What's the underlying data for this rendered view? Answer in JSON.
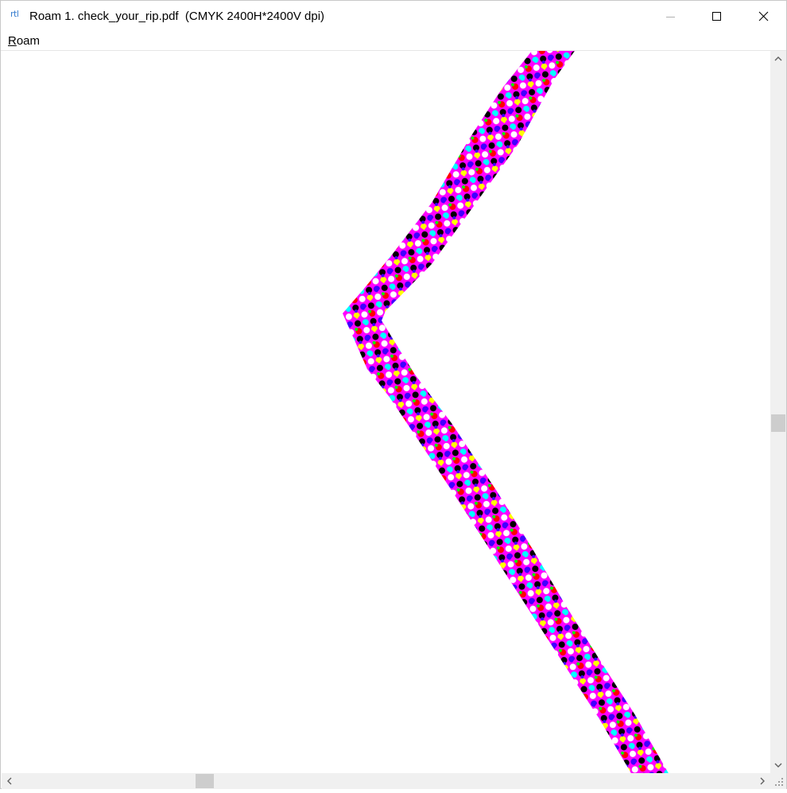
{
  "window": {
    "app_icon": "rtl",
    "title": "Roam 1. check_your_rip.pdf  (CMYK 2400H*2400V dpi)",
    "controls": [
      "minimize-icon",
      "maximize-icon",
      "close-icon"
    ]
  },
  "menu": {
    "items": [
      {
        "label_hotkey": "R",
        "label_rest": "oam"
      }
    ]
  },
  "preview": {
    "content": "zoomed halftone rendering of a chevron-shaped stroke",
    "colors": {
      "base": "#ff00ff",
      "dots": [
        "#000000",
        "#ffffff",
        "#ff0000",
        "#4000ff",
        "#00ffff",
        "#ffff00",
        "#00ff00"
      ]
    }
  },
  "scrollbars": {
    "vertical_icons": [
      "chevron-up-icon",
      "chevron-down-icon"
    ],
    "horizontal_icons": [
      "chevron-left-icon",
      "chevron-right-icon"
    ]
  }
}
